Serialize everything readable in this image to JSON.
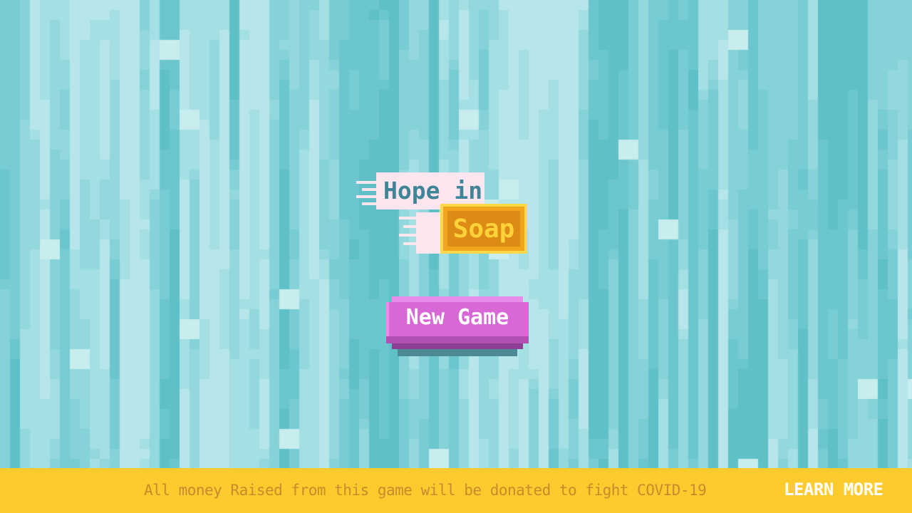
{
  "logo": {
    "line1": "Hope in",
    "line2": "Soap"
  },
  "menu": {
    "new_game_label": "New Game"
  },
  "banner": {
    "message": "All money Raised from this game will be donated to fight COVID-19",
    "learn_more_label": "LEARN MORE"
  },
  "colors": {
    "background": "#7fd0d8",
    "banner": "#fecb2f",
    "button": "#d868d6",
    "soap": "#f0a51c",
    "logo_panel": "#fbe6ef"
  }
}
